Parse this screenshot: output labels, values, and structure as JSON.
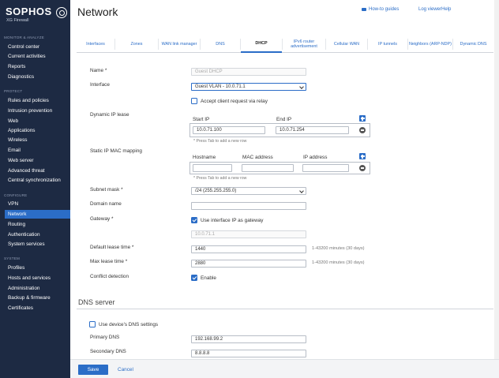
{
  "brand": {
    "name": "SOPHOS",
    "product": "XG Firewall"
  },
  "sidebar": {
    "sections": [
      {
        "title": "MONITOR & ANALYZE",
        "items": [
          "Control center",
          "Current activities",
          "Reports",
          "Diagnostics"
        ]
      },
      {
        "title": "PROTECT",
        "items": [
          "Rules and policies",
          "Intrusion prevention",
          "Web",
          "Applications",
          "Wireless",
          "Email",
          "Web server",
          "Advanced threat",
          "Central synchronization"
        ]
      },
      {
        "title": "CONFIGURE",
        "items": [
          "VPN",
          "Network",
          "Routing",
          "Authentication",
          "System services"
        ]
      },
      {
        "title": "SYSTEM",
        "items": [
          "Profiles",
          "Hosts and services",
          "Administration",
          "Backup & firmware",
          "Certificates"
        ]
      }
    ],
    "active": "Network"
  },
  "header": {
    "title": "Network",
    "links": {
      "how_to": "How-to guides",
      "log_viewer": "Log viewer",
      "help": "Help"
    }
  },
  "tabs": [
    {
      "label": "Interfaces"
    },
    {
      "label": "Zones"
    },
    {
      "label": "WAN link manager"
    },
    {
      "label": "DNS"
    },
    {
      "label": "DHCP",
      "active": true
    },
    {
      "label": "IPv6 router advertisement"
    },
    {
      "label": "Cellular WAN"
    },
    {
      "label": "IP tunnels"
    },
    {
      "label": "Neighbors (ARP-NDP)"
    },
    {
      "label": "Dynamic DNS"
    }
  ],
  "form": {
    "name_label": "Name *",
    "name_value": "Guest DHCP",
    "interface_label": "Interface",
    "interface_value": "Guest VLAN - 10.0.71.1",
    "accept_relay_label": "Accept client request via relay",
    "dynamic_ip_label": "Dynamic IP lease",
    "start_ip_label": "Start IP",
    "end_ip_label": "End IP",
    "start_ip": "10.0.71.100",
    "end_ip": "10.0.71.254",
    "tab_hint": "* Press Tab to add a new row",
    "static_ip_label": "Static IP MAC mapping",
    "hostname_label": "Hostname",
    "mac_label": "MAC address",
    "ip_label": "IP address",
    "subnet_label": "Subnet mask *",
    "subnet_value": "/24 (255.255.255.0)",
    "domain_label": "Domain name",
    "domain_value": "",
    "gateway_label": "Gateway *",
    "gateway_chk_label": "Use interface IP as gateway",
    "gateway_value": "10.0.71.1",
    "default_lease_label": "Default lease time *",
    "default_lease_value": "1440",
    "default_lease_range": "1-43200 minutes (30 days)",
    "max_lease_label": "Max lease time *",
    "max_lease_value": "2880",
    "max_lease_range": "1-43200 minutes (30 days)",
    "conflict_label": "Conflict detection",
    "conflict_chk_label": "Enable"
  },
  "dns": {
    "section_title": "DNS server",
    "use_device_label": "Use device's DNS settings",
    "primary_label": "Primary DNS",
    "primary_value": "192.168.99.2",
    "secondary_label": "Secondary DNS",
    "secondary_value": "8.8.8.8"
  },
  "footer": {
    "save": "Save",
    "cancel": "Cancel"
  },
  "colors": {
    "sidebar_bg": "#1d2a43",
    "accent": "#2b6dc7"
  }
}
